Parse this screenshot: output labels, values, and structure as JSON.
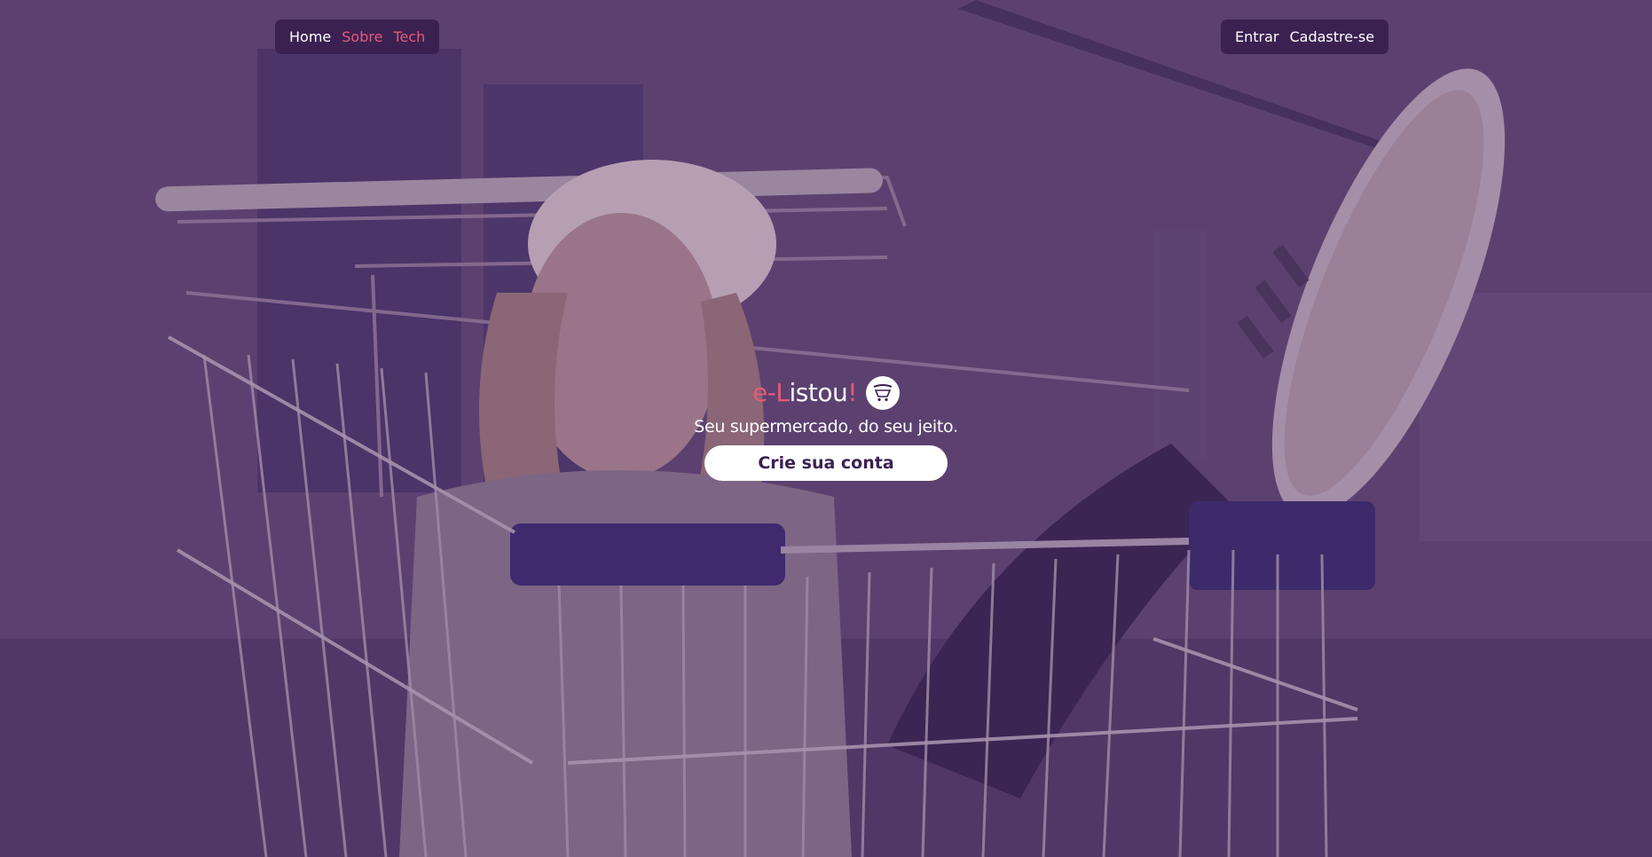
{
  "nav_left": {
    "items": [
      {
        "label": "Home",
        "state": "active"
      },
      {
        "label": "Sobre",
        "state": "accent"
      },
      {
        "label": "Tech",
        "state": "accent"
      }
    ]
  },
  "nav_right": {
    "login_label": "Entrar",
    "signup_label": "Cadastre-se"
  },
  "brand": {
    "logo_prefix": "e-L",
    "logo_main": "istou",
    "logo_suffix": "!"
  },
  "hero": {
    "tagline": "Seu supermercado, do seu jeito.",
    "cta_label": "Crie sua conta",
    "background_icon": "woman-in-shopping-cart-photo"
  },
  "colors": {
    "overlay": "#553a69",
    "nav_bg": "#3b2152",
    "accent": "#e65a78",
    "text_light": "#ffffff",
    "button_text": "#3b2152"
  },
  "icons": {
    "cart": "shopping-cart-icon"
  }
}
